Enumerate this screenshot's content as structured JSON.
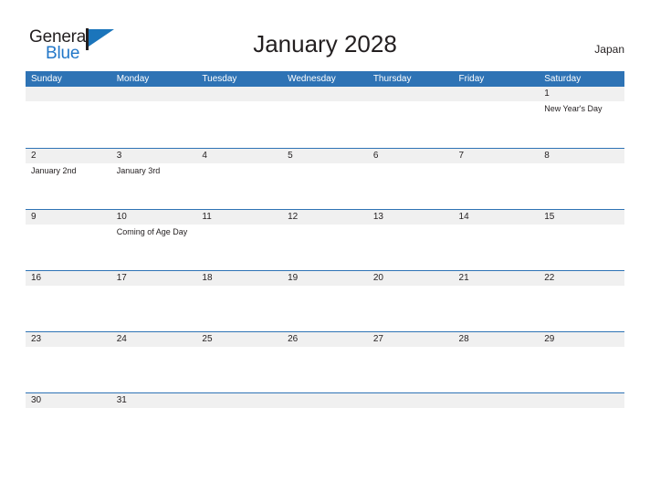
{
  "brand": {
    "name_part1": "General",
    "name_part2": "Blue",
    "flag_icon": "flag-triangle-icon"
  },
  "header": {
    "title": "January 2028",
    "country": "Japan"
  },
  "calendar": {
    "month": "January",
    "year": "2028",
    "colors": {
      "header_blue": "#2e73b5",
      "row_separator": "#2e73b5",
      "row_shade": "#f0f0f0",
      "brand_blue": "#2277c8",
      "text": "#231f20"
    },
    "weekdays": [
      "Sunday",
      "Monday",
      "Tuesday",
      "Wednesday",
      "Thursday",
      "Friday",
      "Saturday"
    ],
    "weeks": [
      [
        {
          "day": "",
          "event": ""
        },
        {
          "day": "",
          "event": ""
        },
        {
          "day": "",
          "event": ""
        },
        {
          "day": "",
          "event": ""
        },
        {
          "day": "",
          "event": ""
        },
        {
          "day": "",
          "event": ""
        },
        {
          "day": "1",
          "event": "New Year's Day"
        }
      ],
      [
        {
          "day": "2",
          "event": "January 2nd"
        },
        {
          "day": "3",
          "event": "January 3rd"
        },
        {
          "day": "4",
          "event": ""
        },
        {
          "day": "5",
          "event": ""
        },
        {
          "day": "6",
          "event": ""
        },
        {
          "day": "7",
          "event": ""
        },
        {
          "day": "8",
          "event": ""
        }
      ],
      [
        {
          "day": "9",
          "event": ""
        },
        {
          "day": "10",
          "event": "Coming of Age Day"
        },
        {
          "day": "11",
          "event": ""
        },
        {
          "day": "12",
          "event": ""
        },
        {
          "day": "13",
          "event": ""
        },
        {
          "day": "14",
          "event": ""
        },
        {
          "day": "15",
          "event": ""
        }
      ],
      [
        {
          "day": "16",
          "event": ""
        },
        {
          "day": "17",
          "event": ""
        },
        {
          "day": "18",
          "event": ""
        },
        {
          "day": "19",
          "event": ""
        },
        {
          "day": "20",
          "event": ""
        },
        {
          "day": "21",
          "event": ""
        },
        {
          "day": "22",
          "event": ""
        }
      ],
      [
        {
          "day": "23",
          "event": ""
        },
        {
          "day": "24",
          "event": ""
        },
        {
          "day": "25",
          "event": ""
        },
        {
          "day": "26",
          "event": ""
        },
        {
          "day": "27",
          "event": ""
        },
        {
          "day": "28",
          "event": ""
        },
        {
          "day": "29",
          "event": ""
        }
      ],
      [
        {
          "day": "30",
          "event": ""
        },
        {
          "day": "31",
          "event": ""
        },
        {
          "day": "",
          "event": ""
        },
        {
          "day": "",
          "event": ""
        },
        {
          "day": "",
          "event": ""
        },
        {
          "day": "",
          "event": ""
        },
        {
          "day": "",
          "event": ""
        }
      ]
    ]
  }
}
